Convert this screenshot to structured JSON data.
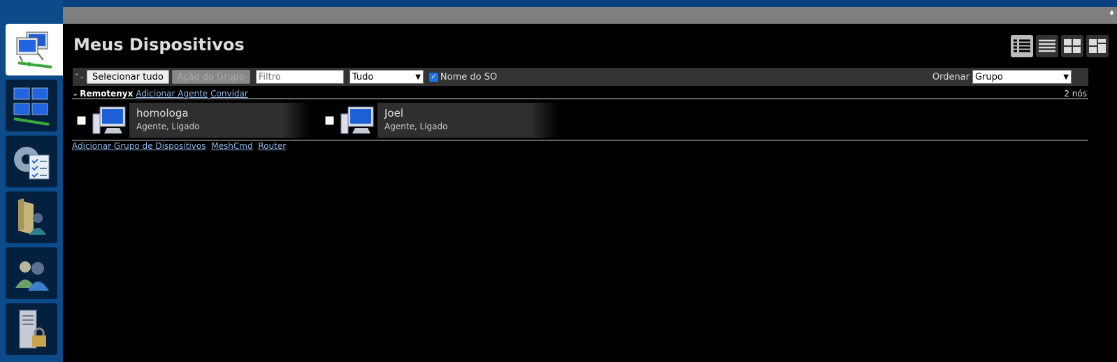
{
  "header": {
    "corner_glyph": "♦"
  },
  "page": {
    "title": "Meus Dispositivos"
  },
  "sidebar": {
    "items": [
      {
        "name": "my-devices",
        "icon": "computers-network-icon"
      },
      {
        "name": "device-groups",
        "icon": "multi-monitor-network-icon"
      },
      {
        "name": "settings",
        "icon": "gear-checklist-icon"
      },
      {
        "name": "files",
        "icon": "folder-user-icon"
      },
      {
        "name": "users",
        "icon": "users-icon"
      },
      {
        "name": "server",
        "icon": "server-lock-icon"
      }
    ]
  },
  "toolbar": {
    "collapse_glyph": "⌃⌄",
    "select_all_label": "Selecionar tudo",
    "group_action_label": "Ação do Grupo",
    "filter_placeholder": "Filtro",
    "filter_value": "",
    "show_select_value": "Tudo",
    "os_name_checked": true,
    "os_name_label": "Nome do SO",
    "sort_label": "Ordenar",
    "sort_value": "Grupo"
  },
  "group": {
    "chevron": "⌄",
    "name": "Remotenyx",
    "add_agent_link": "Adicionar Agente",
    "invite_link": "Convidar",
    "node_count": "2 nós"
  },
  "devices": [
    {
      "name": "homologa",
      "status": "Agente, Ligado"
    },
    {
      "name": "Joel",
      "status": "Agente, Ligado"
    }
  ],
  "footer": {
    "add_group_link": "Adicionar Grupo de Dispositivos",
    "meshcmd_link": "MeshCmd",
    "router_link": "Router"
  },
  "colors": {
    "sidebar": "#0c4a8a",
    "link": "#8fb6e8",
    "checkbox_accent": "#1a73e8"
  }
}
